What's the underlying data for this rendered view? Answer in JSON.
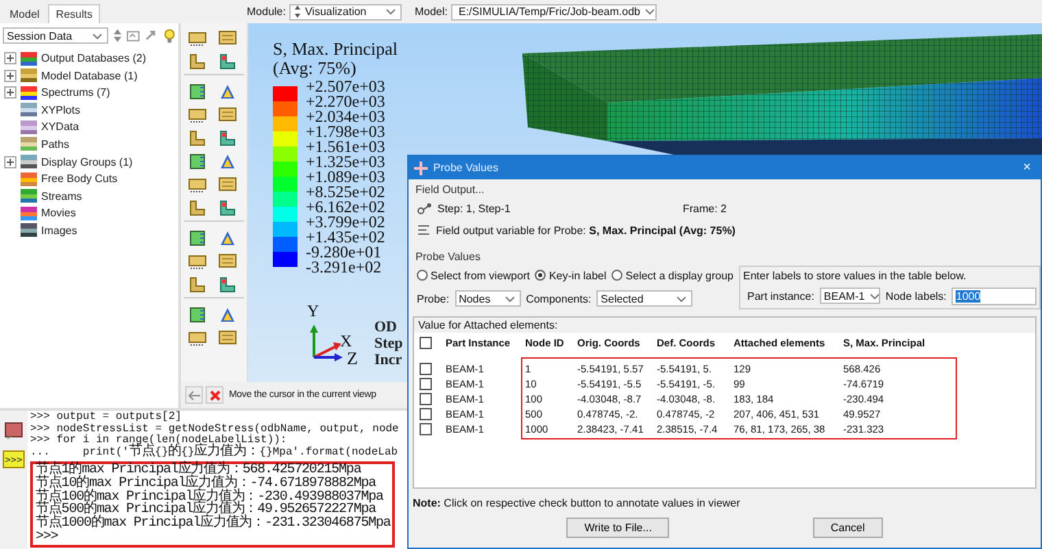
{
  "left_tabs": [
    {
      "label": "Model",
      "selected": false
    },
    {
      "label": "Results",
      "selected": true
    }
  ],
  "toolbar": {
    "module_label": "Module:",
    "module": "Visualization",
    "model_label": "Model:",
    "model": "E:/SIMULIA/Temp/Fric/Job-beam.odb"
  },
  "session": {
    "dropdown": "Session Data"
  },
  "tree": [
    {
      "label": "Output Databases (2)",
      "expandable": true
    },
    {
      "label": "Model Database (1)",
      "expandable": true
    },
    {
      "label": "Spectrums (7)",
      "expandable": true
    },
    {
      "label": "XYPlots",
      "expandable": false
    },
    {
      "label": "XYData",
      "expandable": false
    },
    {
      "label": "Paths",
      "expandable": false
    },
    {
      "label": "Display Groups (1)",
      "expandable": true
    },
    {
      "label": "Free Body Cuts",
      "expandable": false
    },
    {
      "label": "Streams",
      "expandable": false
    },
    {
      "label": "Movies",
      "expandable": false
    },
    {
      "label": "Images",
      "expandable": false
    }
  ],
  "viewport": {
    "legend_title": [
      "S, Max. Principal",
      "(Avg: 75%)"
    ],
    "bands": [
      {
        "color": "#ff0000"
      },
      {
        "color": "#ff5d00"
      },
      {
        "color": "#ffb900"
      },
      {
        "color": "#e8ff00"
      },
      {
        "color": "#8bff00"
      },
      {
        "color": "#2eff00"
      },
      {
        "color": "#00ff2e"
      },
      {
        "color": "#00ff8b"
      },
      {
        "color": "#00ffe8"
      },
      {
        "color": "#00b9ff"
      },
      {
        "color": "#005dff"
      },
      {
        "color": "#0000ff"
      }
    ],
    "labels": [
      "+2.507e+03",
      "+2.270e+03",
      "+2.034e+03",
      "+1.798e+03",
      "+1.561e+03",
      "+1.325e+03",
      "+1.089e+03",
      "+8.525e+02",
      "+6.162e+02",
      "+3.799e+02",
      "+1.435e+02",
      "-9.280e+01",
      "-3.291e+02"
    ],
    "triad": {
      "y": "Y",
      "x": "X",
      "z": "Z"
    },
    "info": [
      "OD",
      "Step",
      "Incr"
    ]
  },
  "prompt": {
    "text": "Move the cursor in the current viewp"
  },
  "console": {
    "prompt_button": ">>>",
    "lines": [
      ">>> output = outputs[2]",
      ">>> nodeStressList = getNodeStress(odbName, output, node",
      ">>> for i in range(len(nodeLabelList)):",
      "...     print('节点{}的{}应力值为：{}Mpa'.format(nodeLab"
    ],
    "results": [
      "节点1的max Principal应力值为：568.425720215Mpa",
      "节点10的max Principal应力值为：-74.6718978882Mpa",
      "节点100的max Principal应力值为：-230.493988037Mpa",
      "节点500的max Principal应力值为：49.9526572227Mpa",
      "节点1000的max Principal应力值为：-231.323046875Mpa",
      ">>>"
    ]
  },
  "dialog": {
    "title": "Probe Values",
    "close": "×",
    "field_output": {
      "label": "Field Output...",
      "step": "Step:  1, Step-1",
      "frame": "Frame:  2",
      "variable": "Field output variable for Probe:  **S, Max. Principal (Avg: 75%)**"
    },
    "probe_values": {
      "label": "Probe Values",
      "radios": [
        {
          "label": "Select from viewport",
          "selected": false
        },
        {
          "label": "Key-in label",
          "selected": true
        },
        {
          "label": "Select a display group",
          "selected": false
        }
      ],
      "probe_label": "Probe:",
      "probe": "Nodes",
      "components_label": "Components:",
      "components": "Selected",
      "hint": "Enter labels to store values in the table below.",
      "part_label": "Part instance:",
      "part": "BEAM-1",
      "node_labels_label": "Node labels:",
      "node_labels": "1000"
    },
    "table": {
      "label": "Value for Attached elements:",
      "header_checked": false,
      "columns": [
        "Part Instance",
        "Node ID",
        "Orig. Coords",
        "Def. Coords",
        "Attached elements",
        "S, Max. Principal"
      ],
      "rows": [
        {
          "checked": false,
          "cells": [
            "BEAM-1",
            "1",
            "-5.54191, 5.57",
            "-5.54191, 5.",
            "129",
            "568.426"
          ]
        },
        {
          "checked": false,
          "cells": [
            "BEAM-1",
            "10",
            "-5.54191, -5.5",
            "-5.54191, -5.",
            "99",
            "-74.6719"
          ]
        },
        {
          "checked": false,
          "cells": [
            "BEAM-1",
            "100",
            "-4.03048, -8.7",
            "-4.03048, -8.",
            "183, 184",
            "-230.494"
          ]
        },
        {
          "checked": false,
          "cells": [
            "BEAM-1",
            "500",
            "0.478745, -2.",
            "0.478745, -2",
            "207, 406, 451, 531",
            "49.9527"
          ]
        },
        {
          "checked": false,
          "cells": [
            "BEAM-1",
            "1000",
            "2.38423, -7.41",
            "2.38515, -7.4",
            "76, 81, 173, 265, 38",
            "-231.323"
          ]
        }
      ]
    },
    "note": "**Note:**  Click on respective check button to annotate values in viewer",
    "buttons": [
      "Write to File...",
      "Cancel"
    ]
  }
}
